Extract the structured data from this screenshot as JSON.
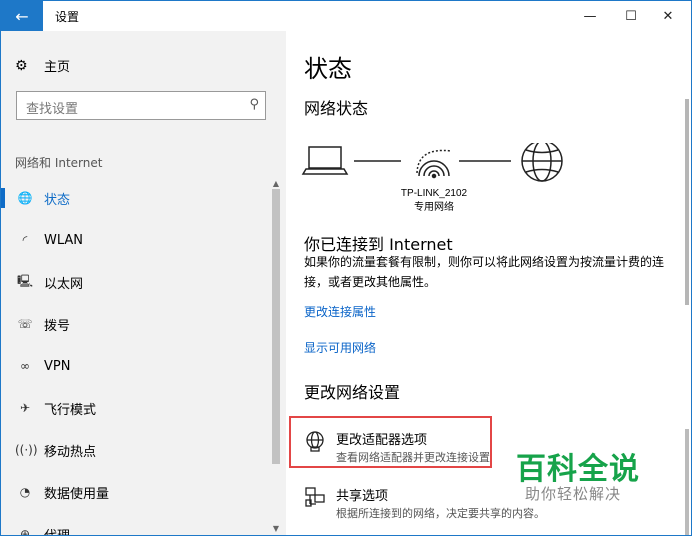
{
  "window": {
    "title": "设置",
    "back_icon": "←",
    "minimize_icon": "—",
    "maximize_icon": "☐",
    "close_icon": "✕"
  },
  "sidebar": {
    "home_label": "主页",
    "home_icon": "gear-icon",
    "search_placeholder": "查找设置",
    "section_label": "网络和 Internet",
    "items": [
      {
        "label": "状态",
        "icon": "globe-icon",
        "active": true
      },
      {
        "label": "WLAN",
        "icon": "wifi-icon"
      },
      {
        "label": "以太网",
        "icon": "ethernet-icon"
      },
      {
        "label": "拨号",
        "icon": "dialup-icon"
      },
      {
        "label": "VPN",
        "icon": "vpn-icon"
      },
      {
        "label": "飞行模式",
        "icon": "airplane-icon"
      },
      {
        "label": "移动热点",
        "icon": "hotspot-icon"
      },
      {
        "label": "数据使用量",
        "icon": "data-usage-icon"
      },
      {
        "label": "代理",
        "icon": "proxy-icon"
      }
    ]
  },
  "main": {
    "title": "状态",
    "network_status_heading": "网络状态",
    "network_name": "TP-LINK_2102",
    "network_type": "专用网络",
    "connected_heading": "你已连接到 Internet",
    "description": "如果你的流量套餐有限制，则你可以将此网络设置为按流量计费的连接，或者更改其他属性。",
    "links": [
      "更改连接属性",
      "显示可用网络"
    ],
    "change_settings_heading": "更改网络设置",
    "options": [
      {
        "title": "更改适配器选项",
        "desc": "查看网络适配器并更改连接设置",
        "icon": "adapter-icon"
      },
      {
        "title": "共享选项",
        "desc": "根据所连接到的网络，决定要共享的内容。",
        "icon": "sharing-icon"
      }
    ]
  },
  "watermark": {
    "title": "百科全说",
    "subtitle": "助你轻松解决"
  },
  "colors": {
    "accent": "#0f6cc7",
    "titlebar_back": "#1e78c8",
    "highlight_border": "#e34646",
    "watermark_green": "#16a34a"
  }
}
